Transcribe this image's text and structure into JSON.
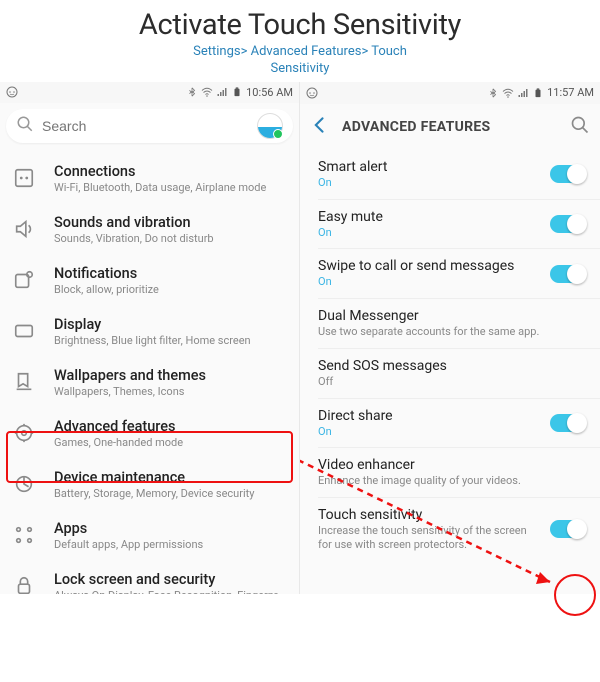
{
  "header": {
    "title": "Activate Touch Sensitivity",
    "breadcrumb_line1": "Settings> Advanced Features> Touch",
    "breadcrumb_line2": "Sensitivity"
  },
  "left": {
    "statusbar": {
      "time": "10:56 AM"
    },
    "search_placeholder": "Search",
    "items": [
      {
        "title": "Connections",
        "sub": "Wi-Fi, Bluetooth, Data usage, Airplane mode"
      },
      {
        "title": "Sounds and vibration",
        "sub": "Sounds, Vibration, Do not disturb"
      },
      {
        "title": "Notifications",
        "sub": "Block, allow, prioritize"
      },
      {
        "title": "Display",
        "sub": "Brightness, Blue light filter, Home screen"
      },
      {
        "title": "Wallpapers and themes",
        "sub": "Wallpapers, Themes, Icons"
      },
      {
        "title": "Advanced features",
        "sub": "Games, One-handed mode"
      },
      {
        "title": "Device maintenance",
        "sub": "Battery, Storage, Memory, Device security"
      },
      {
        "title": "Apps",
        "sub": "Default apps, App permissions"
      },
      {
        "title": "Lock screen and security",
        "sub": "Always On Display, Face Recognition, Fingerprints, Iris"
      }
    ]
  },
  "right": {
    "statusbar": {
      "time": "11:57 AM"
    },
    "appbar_title": "ADVANCED FEATURES",
    "items": [
      {
        "title": "Smart alert",
        "sub": "On",
        "on": true,
        "toggle": true
      },
      {
        "title": "Easy mute",
        "sub": "On",
        "on": true,
        "toggle": true
      },
      {
        "title": "Swipe to call or send messages",
        "sub": "On",
        "on": true,
        "toggle": true
      },
      {
        "title": "Dual Messenger",
        "sub": "Use two separate accounts for the same app.",
        "on": false,
        "toggle": false
      },
      {
        "title": "Send SOS messages",
        "sub": "Off",
        "on": false,
        "toggle": false
      },
      {
        "title": "Direct share",
        "sub": "On",
        "on": true,
        "toggle": true
      },
      {
        "title": "Video enhancer",
        "sub": "Enhance the image quality of your videos.",
        "on": false,
        "toggle": false
      },
      {
        "title": "Touch sensitivity",
        "sub": "Increase the touch sensitivity of the screen for use with screen protectors.",
        "on": true,
        "toggle": true
      }
    ]
  }
}
